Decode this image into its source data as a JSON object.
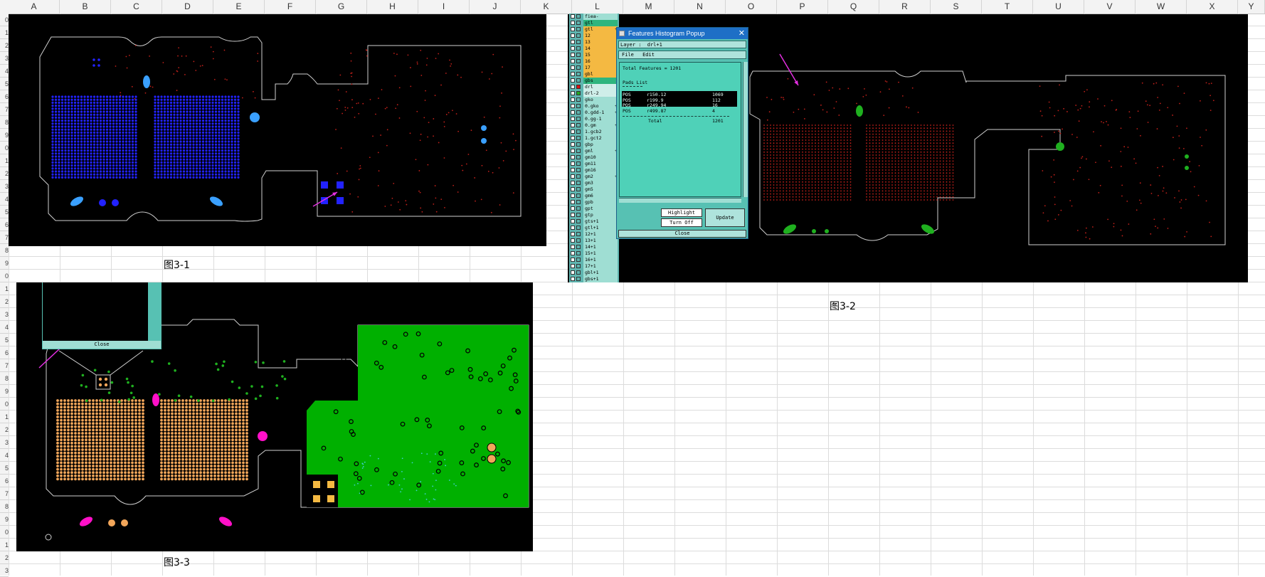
{
  "spreadsheet": {
    "columns": [
      "A",
      "B",
      "C",
      "D",
      "E",
      "F",
      "G",
      "H",
      "I",
      "J",
      "K",
      "L",
      "M",
      "N",
      "O",
      "P",
      "Q",
      "R",
      "S",
      "T",
      "U",
      "V",
      "W",
      "X",
      "Y"
    ],
    "rows": [
      "0",
      "1",
      "2",
      "3",
      "4",
      "5",
      "6",
      "7",
      "8",
      "9",
      "0",
      "1",
      "2",
      "3",
      "4",
      "5",
      "6",
      "7",
      "8",
      "9",
      "0",
      "1",
      "2",
      "3",
      "4",
      "5",
      "6",
      "7",
      "8",
      "9",
      "0",
      "1",
      "2",
      "3",
      "4",
      "5",
      "6",
      "7",
      "8",
      "9",
      "0",
      "1",
      "2",
      "3"
    ]
  },
  "captions": {
    "fig1": "图3-1",
    "fig2": "图3-2",
    "fig3": "图3-3"
  },
  "layers": [
    {
      "label": "fiea-",
      "mark": ""
    },
    {
      "label": "gtl",
      "mark": ""
    },
    {
      "label": "gtl",
      "mark": "+"
    },
    {
      "label": "12",
      "mark": ""
    },
    {
      "label": "13",
      "mark": ""
    },
    {
      "label": "14",
      "mark": ""
    },
    {
      "label": "15",
      "mark": ""
    },
    {
      "label": "16",
      "mark": ""
    },
    {
      "label": "17",
      "mark": ""
    },
    {
      "label": "gbl",
      "mark": ""
    },
    {
      "label": "gbs",
      "mark": ""
    },
    {
      "label": "drl",
      "mark": ""
    },
    {
      "label": "drl-2",
      "mark": ""
    },
    {
      "label": "gko",
      "mark": ""
    },
    {
      "label": "0.gko",
      "mark": "+"
    },
    {
      "label": "0.gdd-1",
      "mark": "+"
    },
    {
      "label": "0.gg-1",
      "mark": ""
    },
    {
      "label": "0.gm",
      "mark": "+"
    },
    {
      "label": "1.gcb2",
      "mark": ""
    },
    {
      "label": "1.gct2",
      "mark": ""
    },
    {
      "label": "gbp",
      "mark": ""
    },
    {
      "label": "gml",
      "mark": "+"
    },
    {
      "label": "gm10",
      "mark": ""
    },
    {
      "label": "gm11",
      "mark": ""
    },
    {
      "label": "gm16",
      "mark": ""
    },
    {
      "label": "gm2",
      "mark": "+"
    },
    {
      "label": "gm3",
      "mark": ""
    },
    {
      "label": "gm5",
      "mark": ""
    },
    {
      "label": "gm6",
      "mark": ""
    },
    {
      "label": "gpb",
      "mark": ""
    },
    {
      "label": "gpt",
      "mark": ""
    },
    {
      "label": "gtp",
      "mark": ""
    },
    {
      "label": "gts+1",
      "mark": ""
    },
    {
      "label": "gtl+1",
      "mark": ""
    },
    {
      "label": "12+1",
      "mark": ""
    },
    {
      "label": "13+1",
      "mark": ""
    },
    {
      "label": "14+1",
      "mark": ""
    },
    {
      "label": "15+1",
      "mark": ""
    },
    {
      "label": "16+1",
      "mark": ""
    },
    {
      "label": "17+1",
      "mark": ""
    },
    {
      "label": "gbl+1",
      "mark": ""
    },
    {
      "label": "gbs+1",
      "mark": ""
    }
  ],
  "popup": {
    "title": "Features Histogram Popup",
    "close_x": "✕",
    "layer_label": "Layer :",
    "layer_value": "drl+1",
    "menu": [
      "File",
      "Edit"
    ],
    "total_features": "Total Features = 1201",
    "pads_list": "Pads List",
    "rows": [
      {
        "type": "POS",
        "symbol": "r150.12",
        "count": "1069"
      },
      {
        "type": "POS",
        "symbol": "r199.9",
        "count": "112"
      },
      {
        "type": "POS",
        "symbol": "r249.94",
        "count": "16"
      },
      {
        "type": "POS",
        "symbol": "r499.87",
        "count": "4"
      }
    ],
    "total_label": "Total",
    "total_value": "1201",
    "highlight": "Highlight",
    "turn_off": "Turn Off",
    "update": "Update",
    "close": "Close"
  },
  "mini_popup": {
    "close": "Close"
  },
  "colors": {
    "board_bg": "#000000",
    "pad_blue": "#2222ff",
    "pad_red": "#c0201a",
    "pad_green": "#1fb01f",
    "pad_orange": "#f2a65a",
    "pad_magenta": "#ff10c8",
    "fill_green": "#00b000",
    "arrow": "#e22fe0",
    "popup_bg": "#57c1b3",
    "layer_orange": "#f4b942",
    "layer_green": "#2fb57e"
  }
}
